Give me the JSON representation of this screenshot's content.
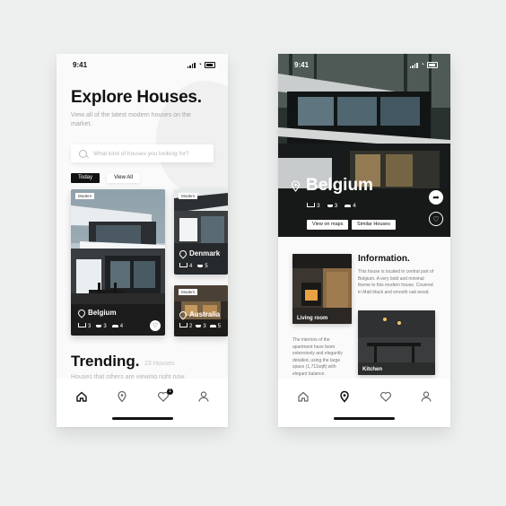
{
  "left_screen": {
    "status_time": "9:41",
    "title": "Explore Houses.",
    "subtitle": "View all of the latest modern houses on the market.",
    "search_placeholder": "What kind of houses you looking for?",
    "chips": {
      "today": "Today",
      "view_all": "View All"
    },
    "cards": [
      {
        "badge": "Modern",
        "location": "Belgium",
        "beds": "3",
        "baths": "3",
        "cars": "4"
      },
      {
        "badge": "Modern",
        "location": "Denmark",
        "beds": "4",
        "baths": "5"
      },
      {
        "badge": "Modern",
        "location": "Australia",
        "beds": "2",
        "baths": "3",
        "cars": "5"
      }
    ],
    "trending": {
      "title": "Trending.",
      "count": "23 Houses",
      "subtitle": "Houses that others are viewing right now."
    },
    "tabbar": {
      "favorites_badge": "1",
      "active": "home"
    }
  },
  "right_screen": {
    "status_time": "9:41",
    "location": "Belgium",
    "features": {
      "beds": "3",
      "baths": "3",
      "cars": "4"
    },
    "buttons": {
      "view_on_maps": "View on maps",
      "similar_houses": "Similar Houses"
    },
    "information": {
      "title": "Information.",
      "text_1": "This house is located in central part of Belgium. A very bold and minimal theme to this modern house. Covered in Matt black and smooth oak wood.",
      "text_2": "The interiors of the apartment have been extensively and elegantly detailed, using the large space (1,711sqft) with elegant balance."
    },
    "photos": {
      "living": "Living room",
      "kitchen": "Kitchen"
    },
    "tabbar": {
      "active": "location"
    }
  },
  "colors": {
    "accent": "#111111",
    "background": "#eef0ef",
    "card_white": "#ffffff",
    "muted_text": "#a6a6a6"
  }
}
